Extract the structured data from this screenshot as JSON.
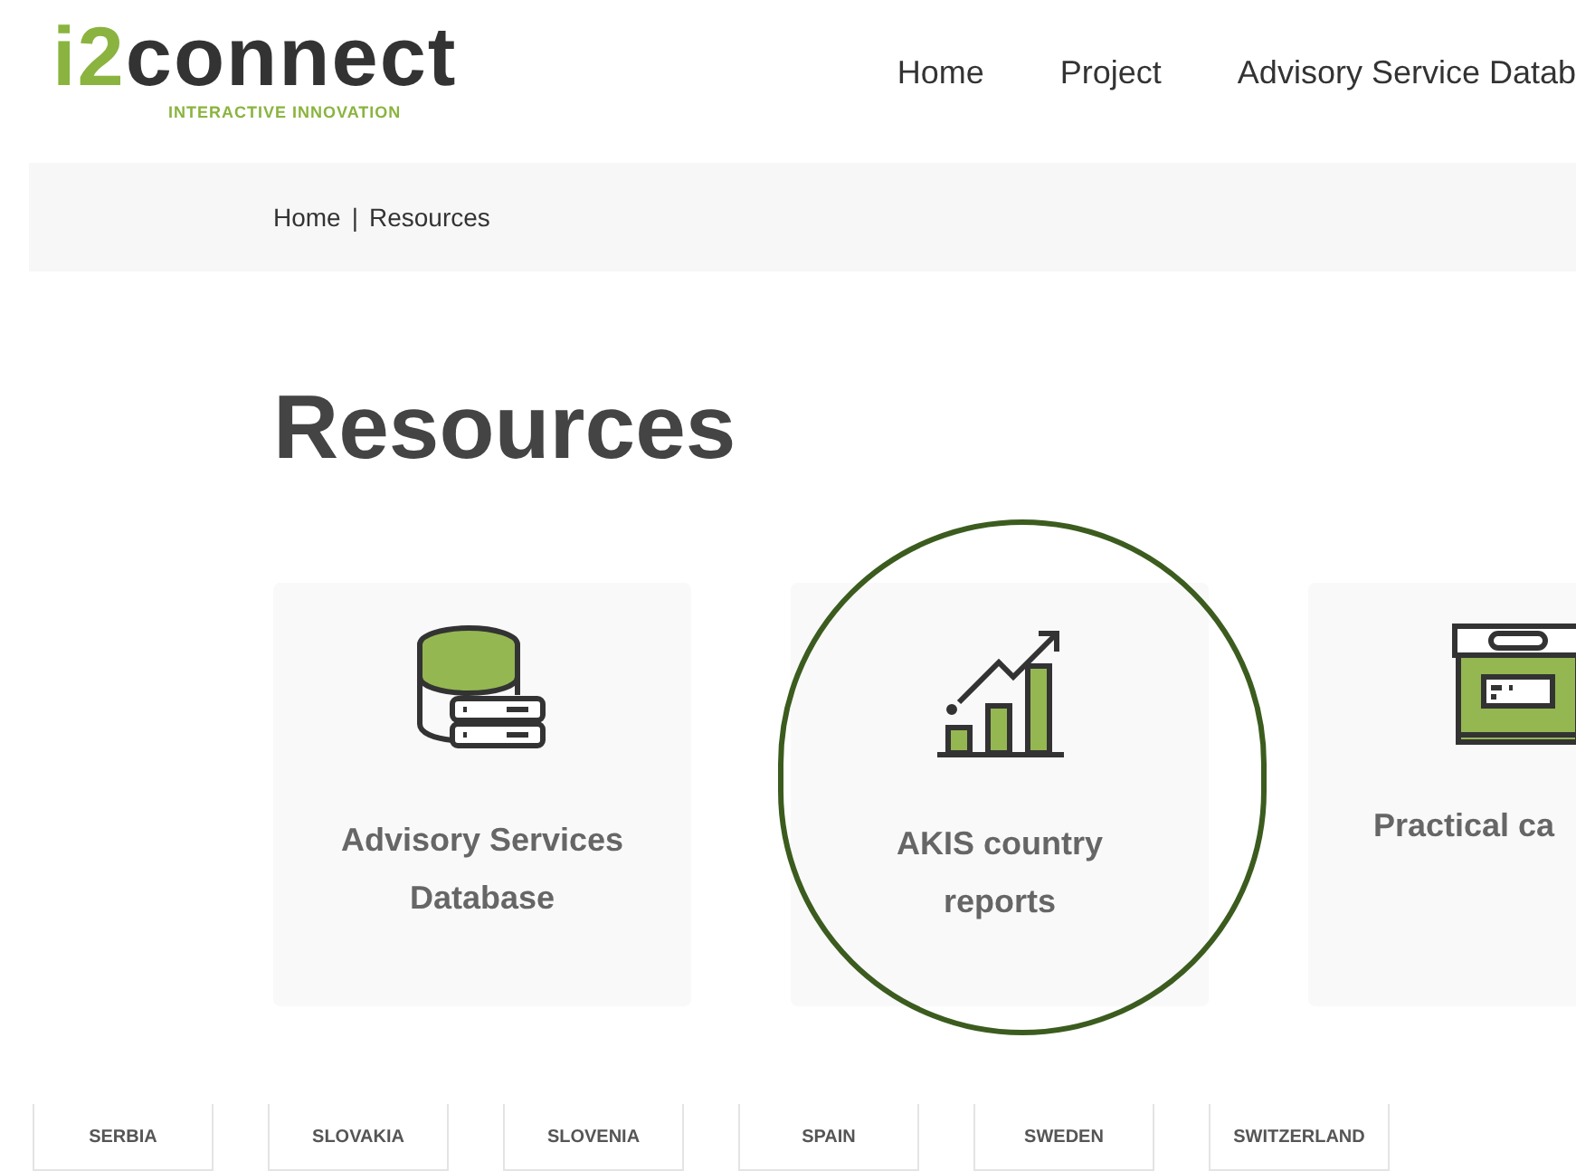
{
  "logo": {
    "prefix": "i2",
    "name": "connect",
    "tagline": "INTERACTIVE INNOVATION"
  },
  "nav": [
    {
      "label": "Home"
    },
    {
      "label": "Project"
    },
    {
      "label": "Advisory Service Datab"
    }
  ],
  "breadcrumb": [
    {
      "label": "Home"
    },
    {
      "label": "Resources"
    }
  ],
  "breadcrumb_separator": "|",
  "heading": "Resources",
  "cards": [
    {
      "kind": "database",
      "title": "Advisory Services Database",
      "highlighted": false
    },
    {
      "kind": "chart",
      "title": "AKIS country reports",
      "highlighted": true
    },
    {
      "kind": "box",
      "title": "Practical ca",
      "highlighted": false
    }
  ],
  "countries": [
    {
      "label": "SERBIA"
    },
    {
      "label": "SLOVAKIA"
    },
    {
      "label": "SLOVENIA"
    },
    {
      "label": "SPAIN"
    },
    {
      "label": "SWEDEN"
    },
    {
      "label": "SWITZERLAND"
    }
  ]
}
